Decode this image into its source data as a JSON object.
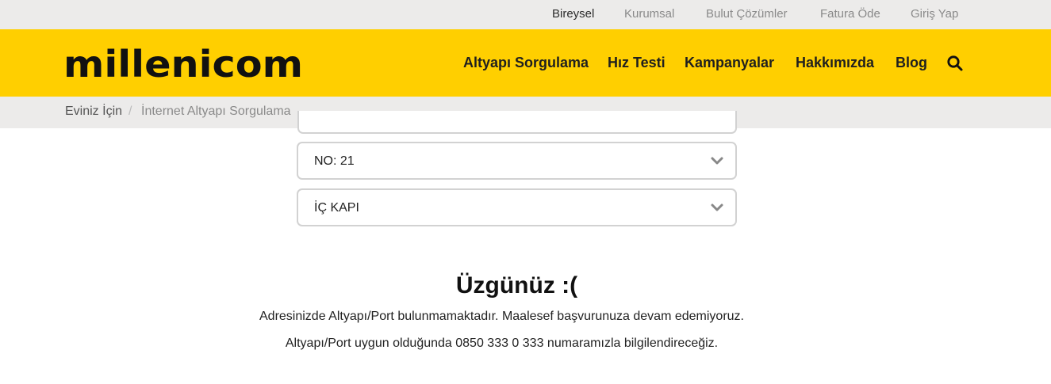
{
  "topbar": {
    "links": [
      {
        "label": "Bireysel",
        "active": true
      },
      {
        "label": "Kurumsal",
        "active": false
      },
      {
        "label": "Bulut Çözümler",
        "active": false
      },
      {
        "label": "Fatura Öde",
        "active": false
      },
      {
        "label": "Giriş Yap",
        "active": false
      }
    ]
  },
  "header": {
    "logo_text": "millenicom",
    "brand_color": "#ffcf00",
    "nav": [
      {
        "label": "Altyapı Sorgulama"
      },
      {
        "label": "Hız Testi"
      },
      {
        "label": "Kampanyalar"
      },
      {
        "label": "Hakkımızda"
      },
      {
        "label": "Blog"
      }
    ],
    "search_icon": "search-icon"
  },
  "breadcrumb": {
    "home": "Eviniz İçin",
    "separator": "/",
    "current": "İnternet Altyapı Sorgulama"
  },
  "form": {
    "selects": [
      {
        "value": "NO: 21",
        "icon": "chevron-down-icon"
      },
      {
        "value": "İÇ KAPI",
        "icon": "chevron-down-icon"
      }
    ]
  },
  "message": {
    "title": "Üzgünüz :(",
    "line1": "Adresinizde Altyapı/Port bulunmamaktadır. Maalesef başvurunuza devam edemiyoruz.",
    "line2": "Altyapı/Port uygun olduğunda 0850 333 0 333 numaramızla bilgilendireceğiz."
  }
}
